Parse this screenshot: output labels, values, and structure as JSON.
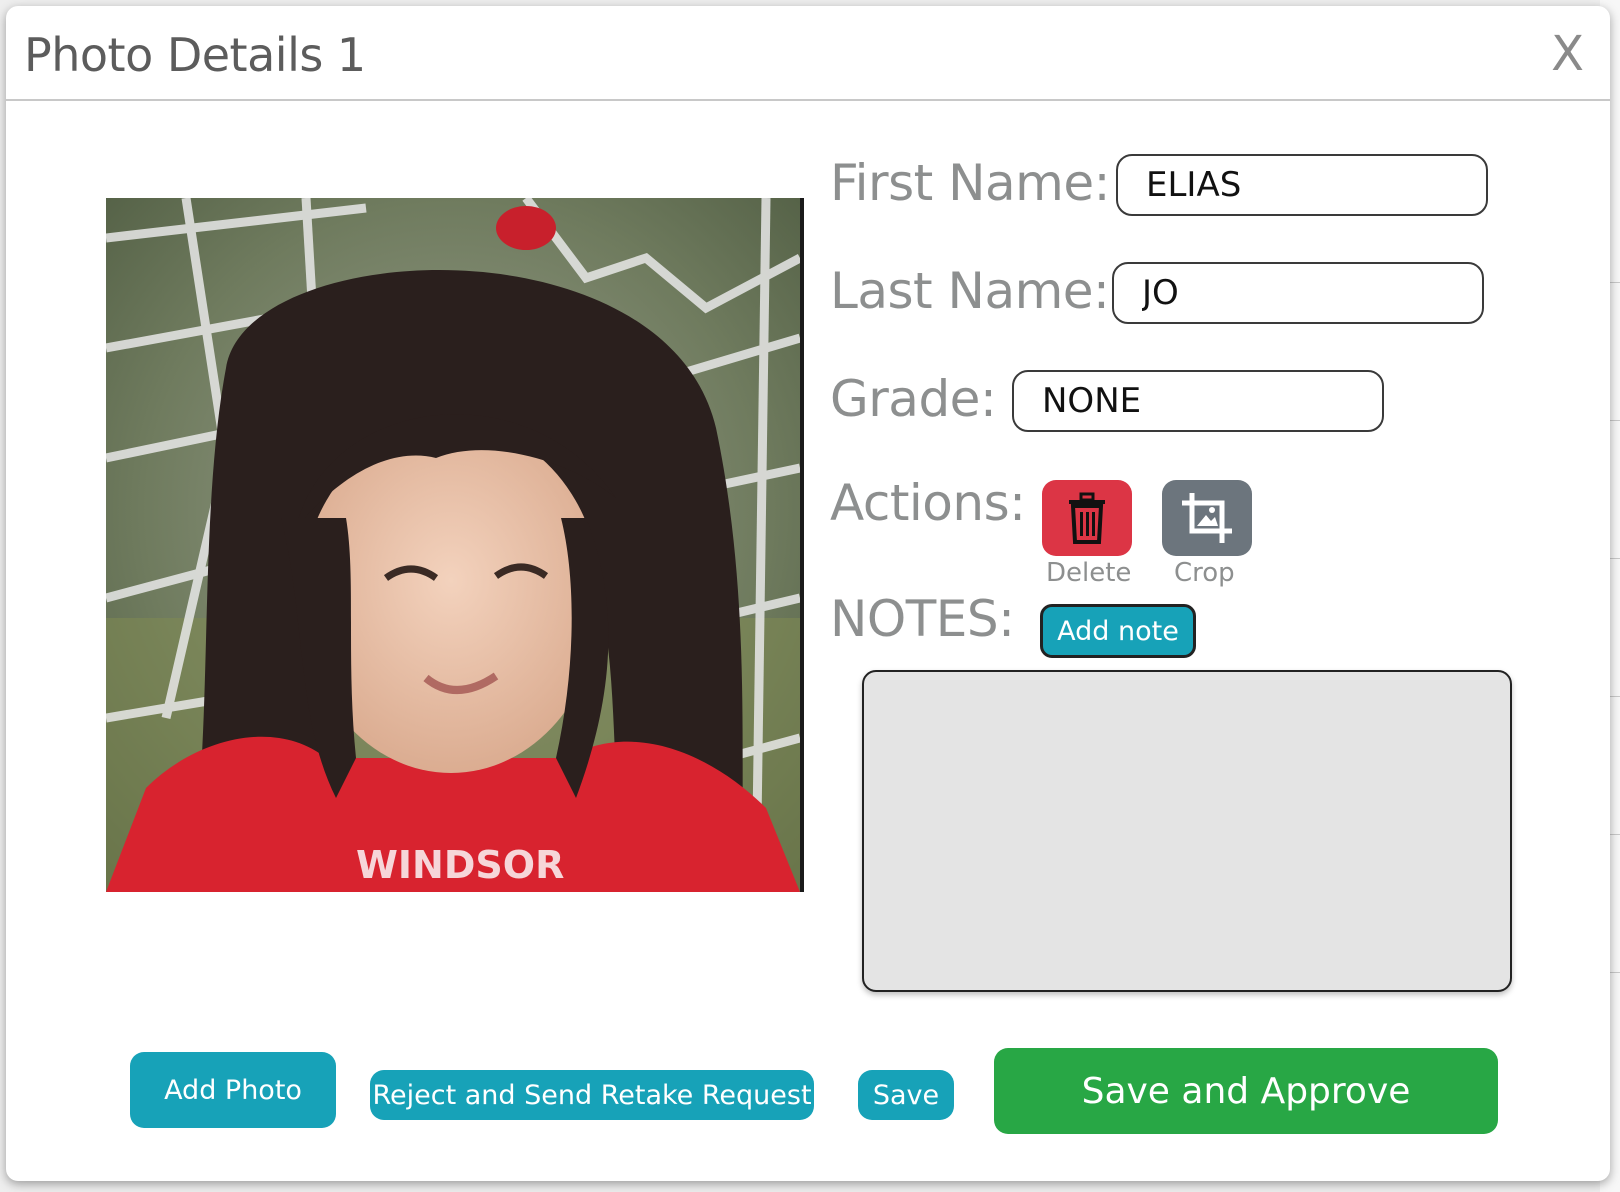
{
  "modal": {
    "title": "Photo Details 1",
    "close_label": "X"
  },
  "form": {
    "first_name_label": "First Name:",
    "first_name_value": "ELIAS",
    "last_name_label": "Last Name:",
    "last_name_value": "JO",
    "grade_label": "Grade:",
    "grade_value": "NONE",
    "actions_label": "Actions:",
    "delete_caption": "Delete",
    "crop_caption": "Crop",
    "notes_label": "NOTES:",
    "add_note_label": "Add note",
    "notes_value": ""
  },
  "photo": {
    "shirt_text": "WINDSOR"
  },
  "footer": {
    "add_photo_label": "Add Photo",
    "reject_label": "Reject and Send Retake Request",
    "save_label": "Save",
    "save_approve_label": "Save and Approve"
  },
  "icons": {
    "delete": "trash-icon",
    "crop": "crop-icon"
  },
  "colors": {
    "delete": "#dc3545",
    "crop": "#6c757d",
    "teal": "#17a2b8",
    "approve": "#28a745"
  }
}
